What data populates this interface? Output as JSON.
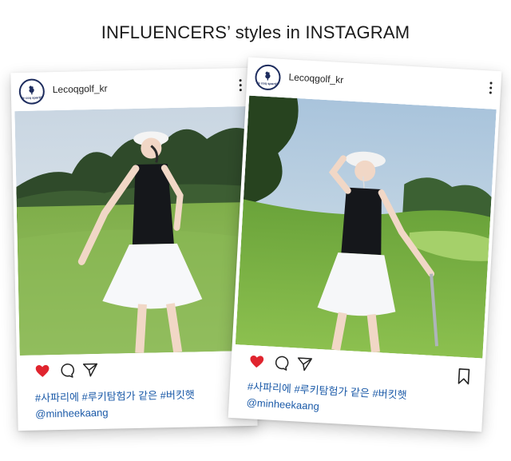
{
  "page": {
    "title": "INFLUENCERS’ styles in INSTAGRAM"
  },
  "colors": {
    "caption": "#1b5aa8",
    "heart": "#e0242e",
    "brand": "#1d2c5e"
  },
  "posts": [
    {
      "username": "Lecoqgolf_kr",
      "avatar_text": "le coq sportif",
      "icons": [
        "heart-filled-icon",
        "comment-icon",
        "share-icon"
      ],
      "hashtags": "#사파리에 #루키탐험가 같은 #버킷햇",
      "mention": "@minheekaang"
    },
    {
      "username": "Lecoqgolf_kr",
      "avatar_text": "le coq sportif",
      "icons": [
        "heart-filled-icon",
        "comment-icon",
        "share-icon",
        "bookmark-icon"
      ],
      "hashtags": "#사파리에 #루키탐험가 같은 #버킷햇",
      "mention": "@minheekaang"
    }
  ]
}
